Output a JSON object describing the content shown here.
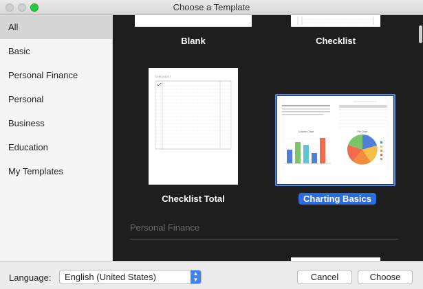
{
  "window": {
    "title": "Choose a Template"
  },
  "sidebar": {
    "items": [
      {
        "label": "All",
        "selected": true
      },
      {
        "label": "Basic"
      },
      {
        "label": "Personal Finance"
      },
      {
        "label": "Personal"
      },
      {
        "label": "Business"
      },
      {
        "label": "Education"
      },
      {
        "label": "My Templates"
      }
    ]
  },
  "gallery": {
    "templates": [
      {
        "label": "Blank"
      },
      {
        "label": "Checklist"
      },
      {
        "label": "Checklist Total"
      },
      {
        "label": "Charting Basics",
        "selected": true
      }
    ],
    "section_header": "Personal Finance",
    "thumbnail_texts": {
      "checklist": "CHECKLIST",
      "column_chart": "Column Chart",
      "pie_chart": "Pie Chart"
    }
  },
  "footer": {
    "language_label": "Language:",
    "language_value": "English (United States)",
    "cancel_label": "Cancel",
    "choose_label": "Choose"
  },
  "colors": {
    "accent": "#2d6ce0",
    "bars": [
      "#4f7fd9",
      "#7cc46a",
      "#5ec4d6",
      "#4f7fd9",
      "#f26b4f"
    ]
  }
}
